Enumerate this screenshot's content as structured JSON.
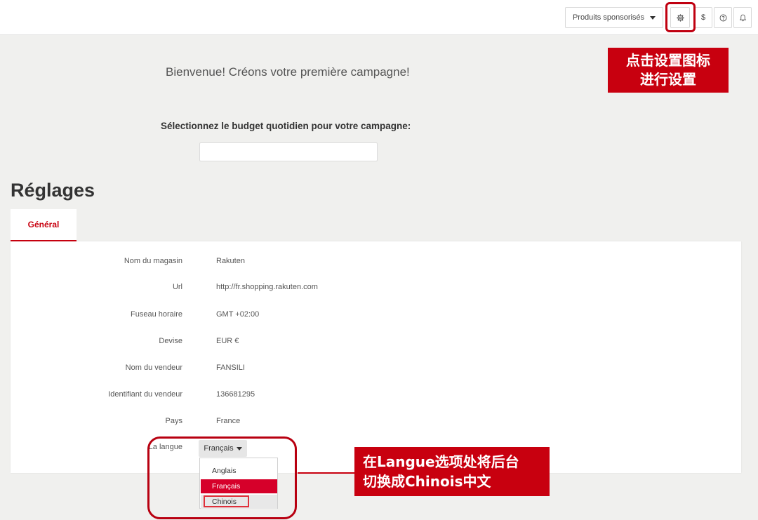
{
  "topbar": {
    "products_label": "Produits sponsorisés",
    "gear_icon": "gear-icon",
    "dollar_symbol": "$",
    "help_icon": "help-circle-icon",
    "bell_icon": "bell-icon"
  },
  "annotations": {
    "top_callout_line1": "点击设置图标",
    "top_callout_line2": "进行设置",
    "lang_callout_line1": "在Langue选项处将后台",
    "lang_callout_line2": "切换成Chinois中文",
    "accent_color": "#c8000f"
  },
  "welcome": {
    "title": "Bienvenue! Créons votre première campagne!",
    "budget_label": "Sélectionnez le budget quotidien pour votre campagne:",
    "budget_value": ""
  },
  "settings": {
    "title": "Réglages",
    "tab_general": "Général",
    "rows": [
      {
        "label": "Nom du magasin",
        "value": "Rakuten"
      },
      {
        "label": "Url",
        "value": "http://fr.shopping.rakuten.com"
      },
      {
        "label": "Fuseau horaire",
        "value": "GMT +02:00"
      },
      {
        "label": "Devise",
        "value": "EUR €"
      },
      {
        "label": "Nom du vendeur",
        "value": "FANSILI"
      },
      {
        "label": "Identifiant du vendeur",
        "value": "136681295"
      },
      {
        "label": "Pays",
        "value": "France"
      }
    ],
    "language": {
      "label": "La langue",
      "selected": "Français",
      "options": [
        "Anglais",
        "Français",
        "Chinois"
      ]
    }
  }
}
